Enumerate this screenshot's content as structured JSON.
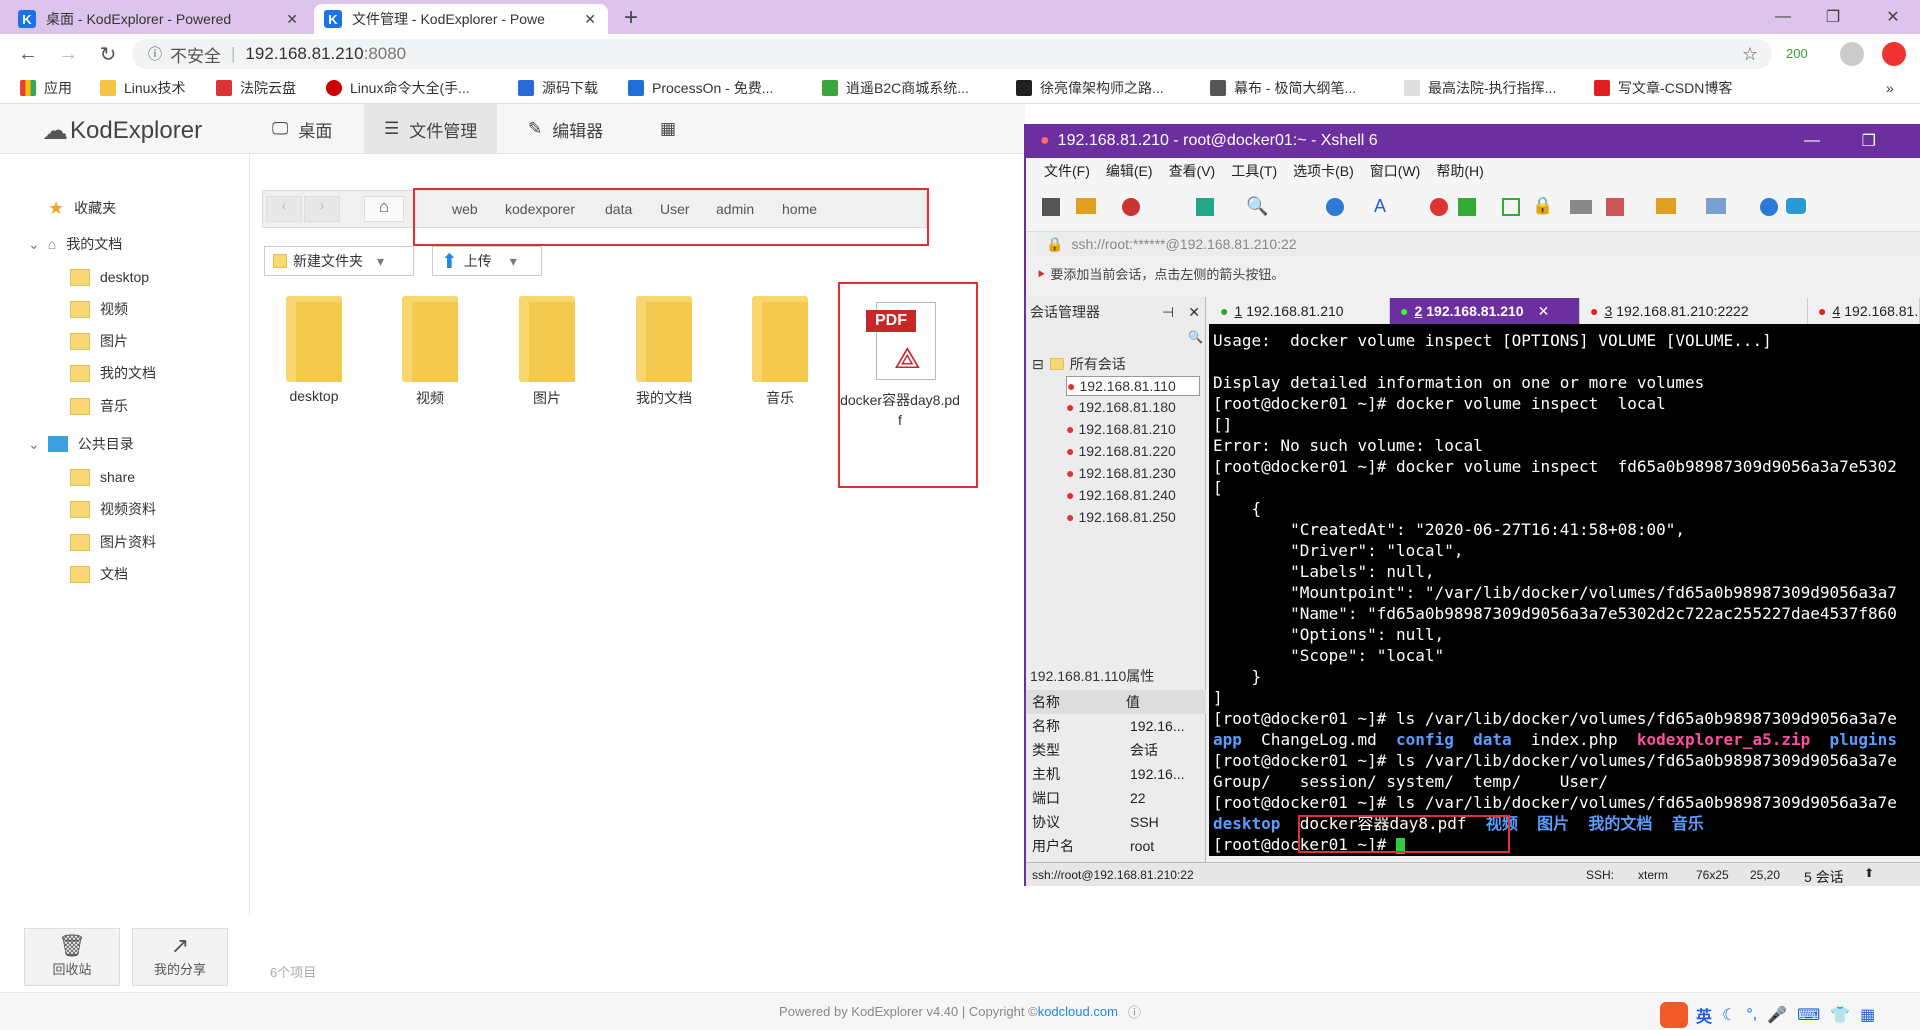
{
  "browser": {
    "tabs": [
      {
        "title": "桌面 - KodExplorer - Powered"
      },
      {
        "title": "文件管理 - KodExplorer - Powe"
      }
    ],
    "new_tab": "+",
    "security": "不安全",
    "url": "192.168.81.210",
    "url_port": ":8080",
    "ext_count": "200",
    "bookmarks": [
      "应用",
      "Linux技术",
      "法院云盘",
      "Linux命令大全(手...",
      "源码下载",
      "ProcessOn - 免费...",
      "逍遥B2C商城系统...",
      "徐亮偉架构师之路...",
      "幕布 - 极简大纲笔...",
      "最高法院-执行指挥...",
      "写文章-CSDN博客"
    ],
    "more": "»"
  },
  "kod": {
    "logo": "KodExplorer",
    "nav": [
      "桌面",
      "文件管理",
      "编辑器"
    ],
    "tree": {
      "favorites": "收藏夹",
      "my_docs": "我的文档",
      "my_children": [
        "desktop",
        "视频",
        "图片",
        "我的文档",
        "音乐"
      ],
      "public": "公共目录",
      "public_children": [
        "share",
        "视频资料",
        "图片资料",
        "文档"
      ]
    },
    "breadcrumb": [
      "web",
      "kodexporer",
      "data",
      "User",
      "admin",
      "home"
    ],
    "new_folder": "新建文件夹",
    "upload": "上传",
    "files": [
      "desktop",
      "视频",
      "图片",
      "我的文档",
      "音乐"
    ],
    "pdf_name": "docker容器day8.pdf",
    "pdf_badge": "PDF",
    "recycle": "回收站",
    "share": "我的分享",
    "item_count": "6个项目",
    "footer": "Powered by KodExplorer v4.40 | Copyright © ",
    "footer_link": "kodcloud.com"
  },
  "xshell": {
    "title": "192.168.81.210 - root@docker01:~ - Xshell 6",
    "menu": [
      "文件(F)",
      "编辑(E)",
      "查看(V)",
      "工具(T)",
      "选项卡(B)",
      "窗口(W)",
      "帮助(H)"
    ],
    "address": "ssh://root:******@192.168.81.210:22",
    "hint": "要添加当前会话，点击左侧的箭头按钮。",
    "session_mgr": "会话管理器",
    "all_sessions": "所有会话",
    "sessions": [
      "192.168.81.110",
      "192.168.81.180",
      "192.168.81.210",
      "192.168.81.220",
      "192.168.81.230",
      "192.168.81.240",
      "192.168.81.250"
    ],
    "tabs": [
      {
        "num": "1",
        "host": "192.168.81.210"
      },
      {
        "num": "2",
        "host": "192.168.81.210"
      },
      {
        "num": "3",
        "host": "192.168.81.210:2222"
      },
      {
        "num": "4",
        "host": "192.168.81."
      }
    ],
    "props_title": "192.168.81.110属性",
    "props_head": [
      "名称",
      "值"
    ],
    "props": [
      [
        "名称",
        "192.16..."
      ],
      [
        "类型",
        "会话"
      ],
      [
        "主机",
        "192.16..."
      ],
      [
        "端口",
        "22"
      ],
      [
        "协议",
        "SSH"
      ],
      [
        "用户名",
        "root"
      ]
    ],
    "terminal": [
      "Usage:  docker volume inspect [OPTIONS] VOLUME [VOLUME...]",
      "",
      "Display detailed information on one or more volumes",
      "[root@docker01 ~]# docker volume inspect  local",
      "[]",
      "Error: No such volume: local",
      "[root@docker01 ~]# docker volume inspect  fd65a0b98987309d9056a3a7e5302",
      "[",
      "    {",
      "        \"CreatedAt\": \"2020-06-27T16:41:58+08:00\",",
      "        \"Driver\": \"local\",",
      "        \"Labels\": null,",
      "        \"Mountpoint\": \"/var/lib/docker/volumes/fd65a0b98987309d9056a3a7",
      "        \"Name\": \"fd65a0b98987309d9056a3a7e5302d2c722ac255227dae4537f860",
      "        \"Options\": null,",
      "        \"Scope\": \"local\"",
      "    }",
      "]",
      "[root@docker01 ~]# ls /var/lib/docker/volumes/fd65a0b98987309d9056a3a7e",
      "",
      "[root@docker01 ~]# ls /var/lib/docker/volumes/fd65a0b98987309d9056a3a7e",
      "Group/   session/ system/  temp/    User/",
      "[root@docker01 ~]# ls /var/lib/docker/volumes/fd65a0b98987309d9056a3a7e",
      "",
      "[root@docker01 ~]# "
    ],
    "ls1": {
      "a": "app",
      "b": "  ChangeLog.md  ",
      "c": "config",
      "d": "  ",
      "e": "data",
      "f": "  index.php  ",
      "g": "kodexplorer_a5.zip",
      "h": "  ",
      "i": "plugins"
    },
    "ls2": {
      "a": "desktop",
      "b": "  docker容器day8.pdf  ",
      "c": "视频",
      "d": "  ",
      "e": "图片",
      "f": "  ",
      "g": "我的文档",
      "h": "  ",
      "i": "音乐"
    },
    "status": {
      "conn": "ssh://root@192.168.81.210:22",
      "proto": "SSH:",
      "term": "xterm",
      "size": "76x25",
      "pos": "25,20",
      "sess": "5 会话"
    }
  },
  "taskbar": {
    "ime": "英"
  },
  "colors": {
    "tabstrip": "#dcc4ec",
    "xshell_title": "#6b2fa0",
    "accent": "#1a73e8",
    "highlight_box": "#e03030"
  }
}
